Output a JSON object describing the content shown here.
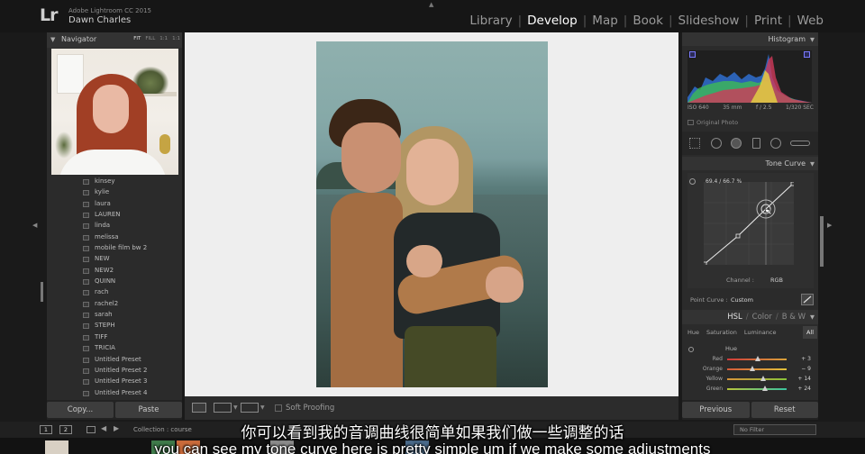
{
  "header": {
    "logo": "Lr",
    "app_name": "Adobe Lightroom CC 2015",
    "user": "Dawn Charles",
    "modules": [
      {
        "label": "Library",
        "active": false
      },
      {
        "label": "Develop",
        "active": true
      },
      {
        "label": "Map",
        "active": false
      },
      {
        "label": "Book",
        "active": false
      },
      {
        "label": "Slideshow",
        "active": false
      },
      {
        "label": "Print",
        "active": false
      },
      {
        "label": "Web",
        "active": false
      }
    ]
  },
  "navigator": {
    "title": "Navigator",
    "zoom_options": [
      "FIT",
      "FILL",
      "1:1",
      "1:1"
    ],
    "active_zoom": "FIT"
  },
  "presets": [
    "kinsey",
    "kylie",
    "laura",
    "LAUREN",
    "linda",
    "melissa",
    "mobile film bw 2",
    "NEW",
    "NEW2",
    "QUINN",
    "rach",
    "rachel2",
    "sarah",
    "STEPH",
    "TIFF",
    "TRICIA",
    "Untitled Preset",
    "Untitled Preset 2",
    "Untitled Preset 3",
    "Untitled Preset 4"
  ],
  "left_buttons": {
    "copy": "Copy...",
    "paste": "Paste"
  },
  "toolbar": {
    "soft_proofing": "Soft Proofing"
  },
  "histogram": {
    "title": "Histogram",
    "iso": "ISO 640",
    "focal": "35 mm",
    "aperture": "f / 2.5",
    "shutter": "1/320 SEC",
    "original_photo": "Original Photo"
  },
  "tone_curve": {
    "title": "Tone Curve",
    "readout": "69.4 / 66.7 %",
    "channel_label": "Channel :",
    "channel_value": "RGB",
    "point_curve_label": "Point Curve :",
    "point_curve_value": "Custom"
  },
  "hsl": {
    "tabs": [
      "HSL",
      "Color",
      "B & W"
    ],
    "active_tab": "HSL",
    "sub_tabs": [
      "Hue",
      "Saturation",
      "Luminance",
      "All"
    ],
    "active_sub": "All",
    "section": "Hue",
    "sliders": [
      {
        "label": "Red",
        "value": "+ 3",
        "pos": 0.52,
        "colors": [
          "#d03a3a",
          "#d8a23a"
        ]
      },
      {
        "label": "Orange",
        "value": "− 9",
        "pos": 0.42,
        "colors": [
          "#d35a3a",
          "#e0c23a"
        ]
      },
      {
        "label": "Yellow",
        "value": "+ 14",
        "pos": 0.6,
        "colors": [
          "#d8943a",
          "#8ac43a"
        ]
      },
      {
        "label": "Green",
        "value": "+ 24",
        "pos": 0.64,
        "colors": [
          "#b8c43a",
          "#3ac4a0"
        ]
      }
    ]
  },
  "right_buttons": {
    "previous": "Previous",
    "reset": "Reset"
  },
  "filmstrip": {
    "page1": "1",
    "page2": "2",
    "collection": "Collection : course",
    "filter": "No Filter"
  },
  "subtitles": {
    "chinese": "你可以看到我的音调曲线很简单如果我们做一些调整的话",
    "english": "you can see my tone curve here is pretty simple um if we make some adjustments"
  },
  "colors": {
    "accent": "#ffffff",
    "panel": "#2b2b2b",
    "background": "#1a1a1a"
  }
}
